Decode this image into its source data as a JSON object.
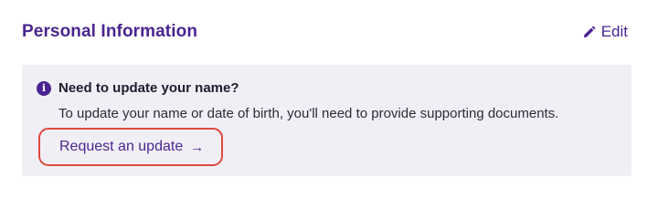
{
  "section": {
    "title": "Personal Information",
    "edit_label": "Edit",
    "edit_icon": "pencil-icon"
  },
  "notice": {
    "icon": "info-icon",
    "icon_glyph": "i",
    "heading": "Need to update your name?",
    "body": "To update your name or date of birth, you'll need to provide supporting documents.",
    "link_label": "Request an update",
    "link_arrow": "→"
  },
  "colors": {
    "accent": "#4a2591",
    "panel_background": "#f1eff6",
    "highlight_outline": "#e0493d"
  }
}
